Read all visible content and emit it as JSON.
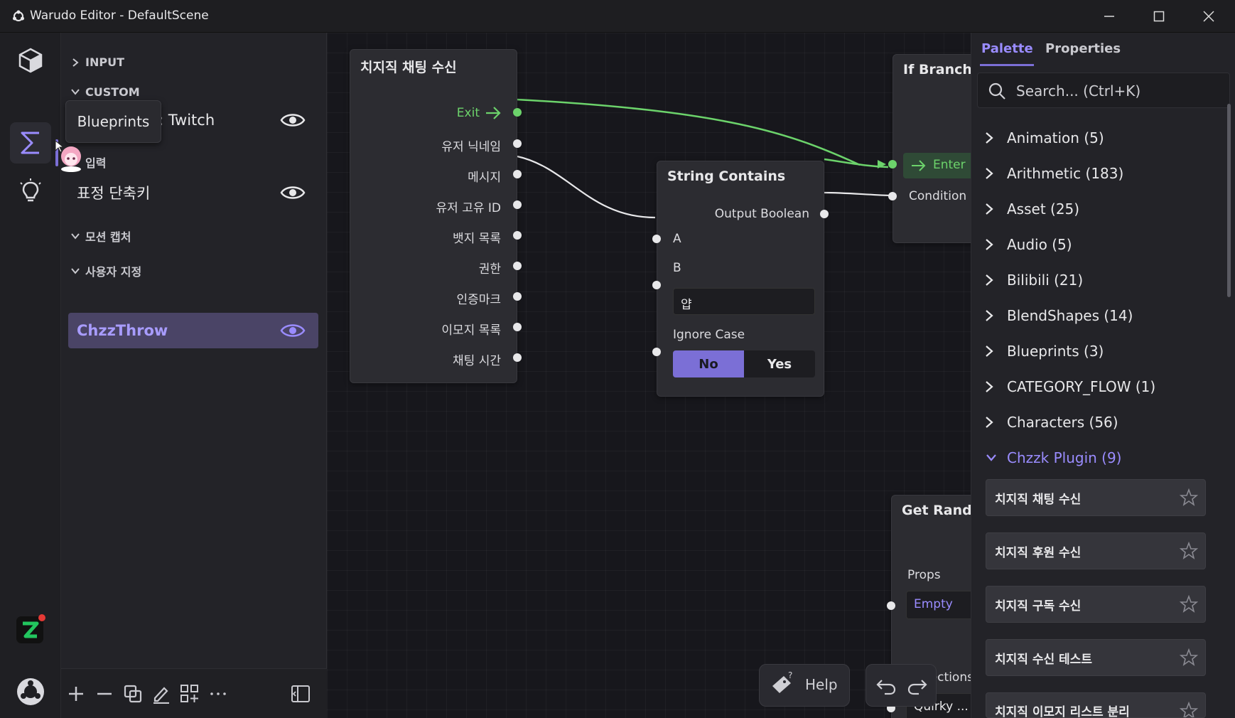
{
  "window": {
    "title": "Warudo Editor - DefaultScene"
  },
  "activity_bar": {
    "tooltip": "Blueprints",
    "badge_color": "#e53935",
    "logo_color": "#22c55e"
  },
  "left_panel": {
    "sections": {
      "input": "INPUT",
      "custom": "CUSTOM",
      "korean_input": "입력",
      "motion_capture": "모션 캡처",
      "user_defined": "사용자 지정"
    },
    "items": {
      "twitch": "s: Twitch",
      "expression_hotkeys": "표정 단축키",
      "chzz_throw": "ChzzThrow"
    }
  },
  "canvas": {
    "chat_node": {
      "title": "치지직 채팅 수신",
      "exit": "Exit",
      "ports": [
        "유저 닉네임",
        "메시지",
        "유저 고유 ID",
        "뱃지 목록",
        "권한",
        "인증마크",
        "이모지 목록",
        "채팅 시간"
      ]
    },
    "string_contains": {
      "title": "String Contains",
      "output": "Output Boolean",
      "a": "A",
      "b": "B",
      "b_value": "얍",
      "ignore_case": "Ignore Case",
      "no": "No",
      "yes": "Yes"
    },
    "if_branch": {
      "title": "If Branch",
      "enter": "Enter",
      "condition": "Condition"
    },
    "get_random": {
      "title": "Get Randor",
      "props": "Props",
      "props_value": "Empty",
      "collections": "Collections",
      "collections_value": "Quirky ..."
    },
    "help_label": "Help"
  },
  "right_panel": {
    "tabs": {
      "palette": "Palette",
      "properties": "Properties"
    },
    "search": {
      "placeholder": "Search... (Ctrl+K)"
    },
    "categories": [
      "Animation (5)",
      "Arithmetic (183)",
      "Asset (25)",
      "Audio (5)",
      "Bilibili (21)",
      "BlendShapes (14)",
      "Blueprints (3)",
      "CATEGORY_FLOW (1)",
      "Characters (56)",
      "Chzzk Plugin (9)"
    ],
    "plugin_nodes": [
      "치지직 채팅 수신",
      "치지직 후원 수신",
      "치지직 구독 수신",
      "치지직 수신 테스트",
      "치지직 이모지 리스트 분리"
    ]
  },
  "colors": {
    "accent": "#7b6fd6",
    "flow_wire": "#6cd36b",
    "data_wire": "#e8e8ea"
  }
}
